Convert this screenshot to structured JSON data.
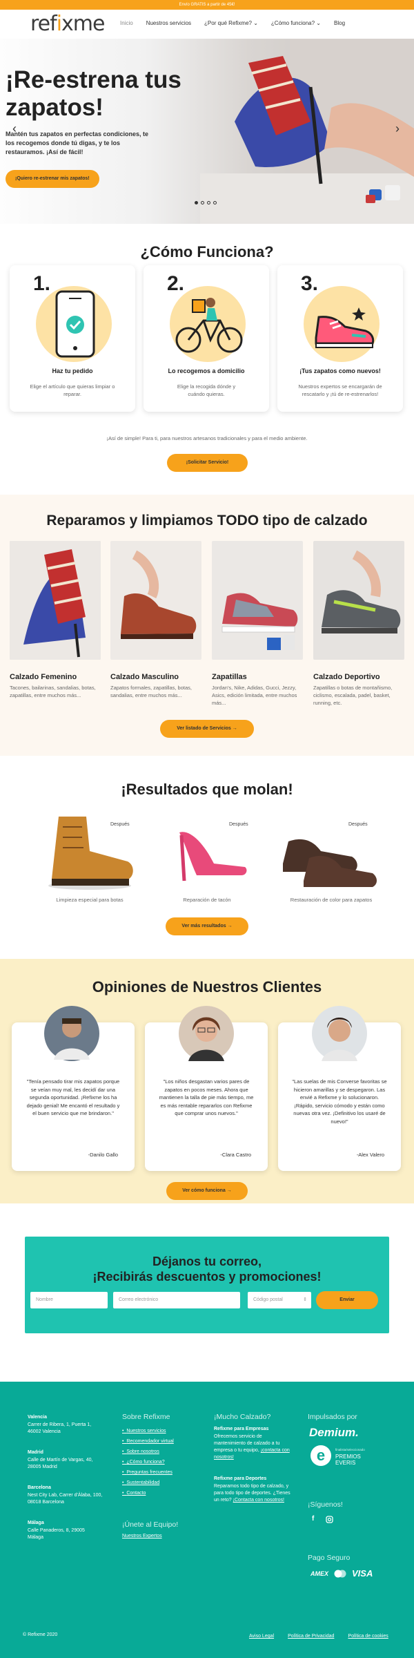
{
  "topbar": {
    "text": "Envío GRATIS a partir de 45€!"
  },
  "nav": {
    "logo_a": "ref",
    "logo_b": "i",
    "logo_c": "xme",
    "items": [
      "Inicio",
      "Nuestros servicios",
      "¿Por qué Refixme?",
      "¿Cómo funciona?",
      "Blog"
    ],
    "chevron": "⌄"
  },
  "hero": {
    "title": "¡Re-estrena tus zapatos!",
    "text": "Mantén tus zapatos en perfectas condiciones, te los recogemos donde tú digas, y te los restauramos. ¡Así de fácil!",
    "button": "¡Quiero re-estrenar mis zapatos!",
    "prev": "‹",
    "next": "›"
  },
  "como": {
    "title": "¿Cómo Funciona?",
    "steps": [
      {
        "num": "1.",
        "title": "Haz tu pedido",
        "desc": "Elige el artículo que quieras limpiar o reparar."
      },
      {
        "num": "2.",
        "title": "Lo recogemos a domicilio",
        "desc": "Elige la recogida dónde y cuándo quieras."
      },
      {
        "num": "3.",
        "title": "¡Tus zapatos como nuevos!",
        "desc": "Nuestros expertos se encargarán de rescatarlo y ¡tú de re-estrenarlos!"
      }
    ],
    "note": "¡Así de simple! Para ti, para nuestros artesanos tradicionales y para el medio ambiente.",
    "button": "¡Solicitar Servicio!"
  },
  "calzado": {
    "title": "Reparamos y limpiamos TODO tipo de calzado",
    "items": [
      {
        "title": "Calzado Femenino",
        "desc": "Tacones, bailarinas, sandalias, botas, zapatillas, entre muchos más..."
      },
      {
        "title": "Calzado Masculino",
        "desc": "Zapatos formales, zapatillas, botas, sandalias, entre muchos más..."
      },
      {
        "title": "Zapatillas",
        "desc": "Jordan's, Nike, Adidas, Gucci, Jezzy, Asics, edición limitada, entre muchos más..."
      },
      {
        "title": "Calzado Deportivo",
        "desc": "Zapatillas o botas de montañismo, ciclismo, escalada, padel, basket, running, etc."
      }
    ],
    "button": "Ver listado de Servicios"
  },
  "resultados": {
    "title": "¡Resultados que molan!",
    "despues": "Después",
    "items": [
      "Limpieza especial para botas",
      "Reparación de tacón",
      "Restauración de color para zapatos"
    ],
    "button": "Ver más resultados"
  },
  "opiniones": {
    "title": "Opiniones de Nuestros Clientes",
    "items": [
      {
        "quote": "\"Tenía pensado tirar mis zapatos porque se veían muy mal, les decidí dar una segunda oportunidad. ¡Refixme los ha dejado genial! Me encantó el resultado y el buen servicio que me brindaron.\"",
        "name": "-Danilo Gallo"
      },
      {
        "quote": "\"Los niños desgastan varios pares de zapatos en pocos meses. Ahora que mantienen la talla de pie más tiempo, me es más rentable repararlos con Refixme que comprar unos nuevos.\"",
        "name": "-Clara Castro"
      },
      {
        "quote": "\"Las suelas de mis Converse favoritas se hicieron amarillas y se despegaron. Las envié a Refixme y lo solucionaron. ¡Rápido, servicio cómodo y están como nuevas otra vez. ¡Definitivo los usaré de nuevo!\"",
        "name": "-Alex Valero"
      }
    ],
    "button": "Ver cómo funciona"
  },
  "newsletter": {
    "title1": "Déjanos tu correo,",
    "title2": "¡Recibirás descuentos y promociones!",
    "name_ph": "Nombre",
    "email_ph": "Correo electrónico",
    "cp_ph": "Código postal",
    "button": "Enviar"
  },
  "footer": {
    "cities": [
      {
        "name": "Valencia",
        "addr": "Carrer de Ribera, 1, Puerta 1, 46002 Valencia"
      },
      {
        "name": "Madrid",
        "addr": "Calle de Martín de Vargas, 40, 28005 Madrid"
      },
      {
        "name": "Barcelona",
        "addr": "Nest City Lab, Carrer d'Àlaba, 100, 08018 Barcelona"
      },
      {
        "name": "Málaga",
        "addr": "Calle Panaderos, 8, 29005 Málaga"
      }
    ],
    "sobre_title": "Sobre Refixme",
    "sobre_links": [
      "Nuestros servicios",
      "Recomendador virtual",
      "Sobre nosotros",
      "¿Cómo funciona?",
      "Preguntas frecuentes",
      "Sustentabilidad",
      "Contacto"
    ],
    "unete_title": "¡Únete al Equipo!",
    "unete_link": "Nuestros Expertos",
    "mucho_title": "¡Mucho Calzado?",
    "emp_title": "Refixme para Empresas",
    "emp_text": "Ofrecemos servicio de mantenimiento de calzado a tu empresa o tu equipo,",
    "emp_link": "¡contacta con nosotros!",
    "dep_title": "Refixme para Deportes",
    "dep_text": "Reparamos todo tipo de calzado, y para todo tipo de deportes. ¿Tienes un reto?",
    "dep_link": "¡Contacta con nosotros!",
    "imp_title": "Impulsados por",
    "demium": "Demium.",
    "everis_small": "finalista/seleccionado",
    "everis": "PREMIOS EVERIS",
    "siguenos": "¡Síguenos!",
    "pago": "Pago Seguro",
    "amex": "AMEX",
    "visa": "VISA",
    "copy": "© Refixme 2020",
    "legal": [
      "Aviso Legal",
      "Política de Privacidad",
      "Política de cookies"
    ]
  },
  "colors": {
    "accent": "#f7a21b",
    "teal": "#08aa97",
    "teal_light": "#1fc3b0",
    "cream": "#fbefc7"
  }
}
